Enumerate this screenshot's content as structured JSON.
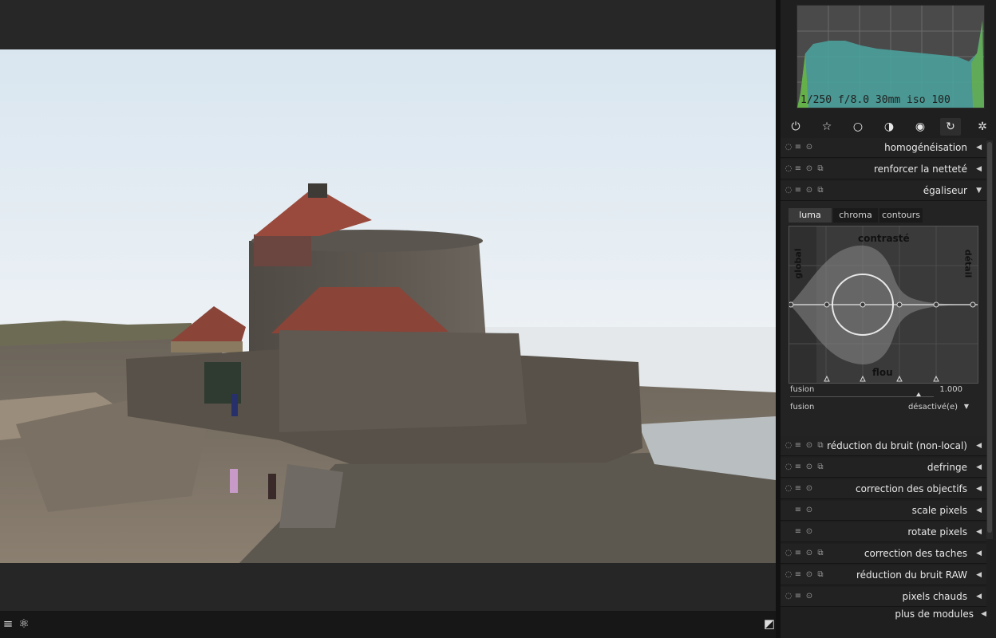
{
  "histogram": {
    "info": "1/250 f/8.0 30mm iso 100"
  },
  "tabs": [
    {
      "name": "power-icon",
      "glyph": "⏻"
    },
    {
      "name": "favorites-star-icon",
      "glyph": "☆"
    },
    {
      "name": "basic-group-circle-icon",
      "glyph": "○"
    },
    {
      "name": "tone-group-icon",
      "glyph": "◑"
    },
    {
      "name": "color-group-icon",
      "glyph": "◉"
    },
    {
      "name": "correct-group-icon",
      "glyph": "↻"
    },
    {
      "name": "effects-group-icon",
      "glyph": "✲"
    }
  ],
  "modules_top": [
    {
      "label": "homogénéisation",
      "arrow": "◀"
    },
    {
      "label": "renforcer la netteté",
      "arrow": "◀"
    },
    {
      "label": "égaliseur",
      "arrow": "▼"
    }
  ],
  "equalizer": {
    "tabs": [
      "luma",
      "chroma",
      "contours"
    ],
    "graph_labels": {
      "top": "contrasté",
      "bottom": "flou",
      "left": "global",
      "right": "détail"
    },
    "slider1": {
      "label": "fusion",
      "value": "1.000"
    },
    "combo": {
      "label": "fusion",
      "value": "désactivé(e)",
      "arrow": "▼"
    }
  },
  "modules_bottom": [
    {
      "label": "réduction du bruit (non-local)",
      "arrow": "◀"
    },
    {
      "label": "defringe",
      "arrow": "◀"
    },
    {
      "label": "correction des objectifs",
      "arrow": "◀"
    },
    {
      "label": "scale pixels",
      "arrow": "◀"
    },
    {
      "label": "rotate pixels",
      "arrow": "◀"
    },
    {
      "label": "correction des taches",
      "arrow": "◀"
    },
    {
      "label": "réduction du bruit RAW",
      "arrow": "◀"
    },
    {
      "label": "pixels chauds",
      "arrow": "◀"
    }
  ],
  "more_modules": {
    "label": "plus de modules",
    "arrow": "◀"
  },
  "bottom_bar": {
    "menu_glyph": "≡",
    "styles_glyph": "⚛",
    "compare_glyph": "◩"
  },
  "colors": {
    "accent": "#4aa4a0",
    "panel": "#1f1f1f",
    "viewport": "#262626"
  }
}
